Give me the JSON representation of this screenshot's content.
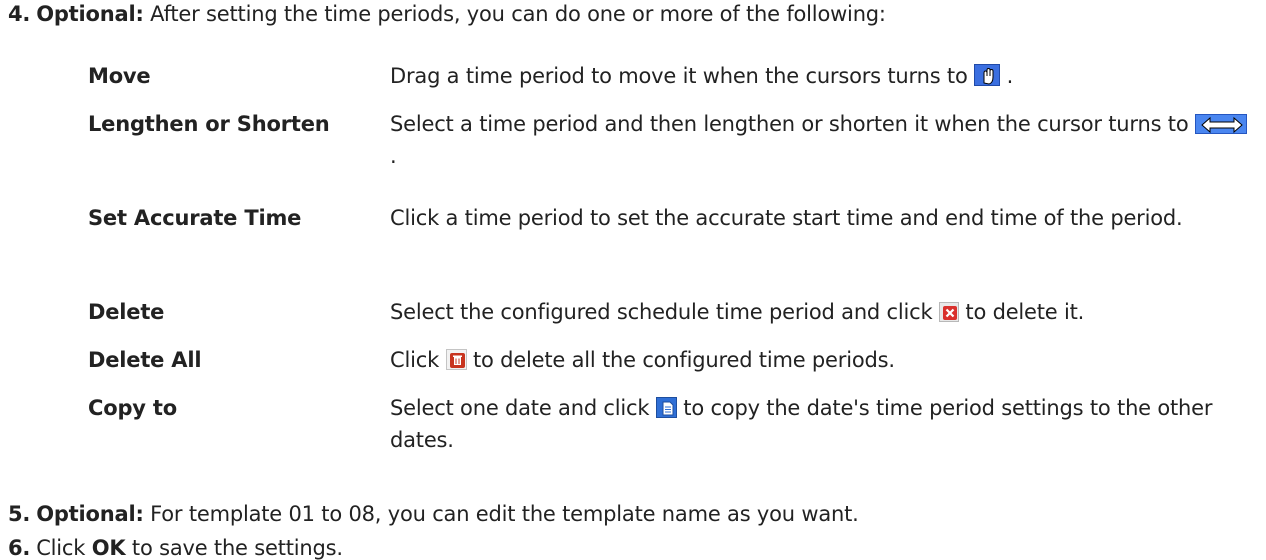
{
  "step4": {
    "num": "4.",
    "bold": "Optional:",
    "text": " After setting the time periods, you can do one or more of the following:"
  },
  "options": [
    {
      "term": "Move",
      "desc_before": "Drag a time period to move it when the cursors turns to ",
      "desc_after": " .",
      "icon": "hand-cursor-icon"
    },
    {
      "term": "Lengthen or Shorten",
      "desc_before": "Select a time period and then lengthen or shorten it when the cursor turns to ",
      "desc_after": " .",
      "icon": "resize-cursor-icon"
    },
    {
      "term": "Set Accurate Time",
      "desc": "Click a time period to set the accurate start time and end time of the period."
    },
    {
      "term": "Delete",
      "desc_before": "Select the configured schedule time period and click ",
      "desc_after": " to delete it.",
      "icon": "delete-icon"
    },
    {
      "term": "Delete All",
      "desc_before": "Click ",
      "desc_after": " to delete all the configured time periods.",
      "icon": "trash-icon"
    },
    {
      "term": "Copy to",
      "desc_before": "Select one date and click ",
      "desc_after": " to copy the date's time period settings to the other dates.",
      "icon": "copy-icon"
    }
  ],
  "step5": {
    "num": "5.",
    "bold": "Optional:",
    "text": " For template 01 to 08, you can edit the template name as you want."
  },
  "step6": {
    "num": "6.",
    "before": "Click ",
    "bold": "OK",
    "after": " to save the settings."
  }
}
